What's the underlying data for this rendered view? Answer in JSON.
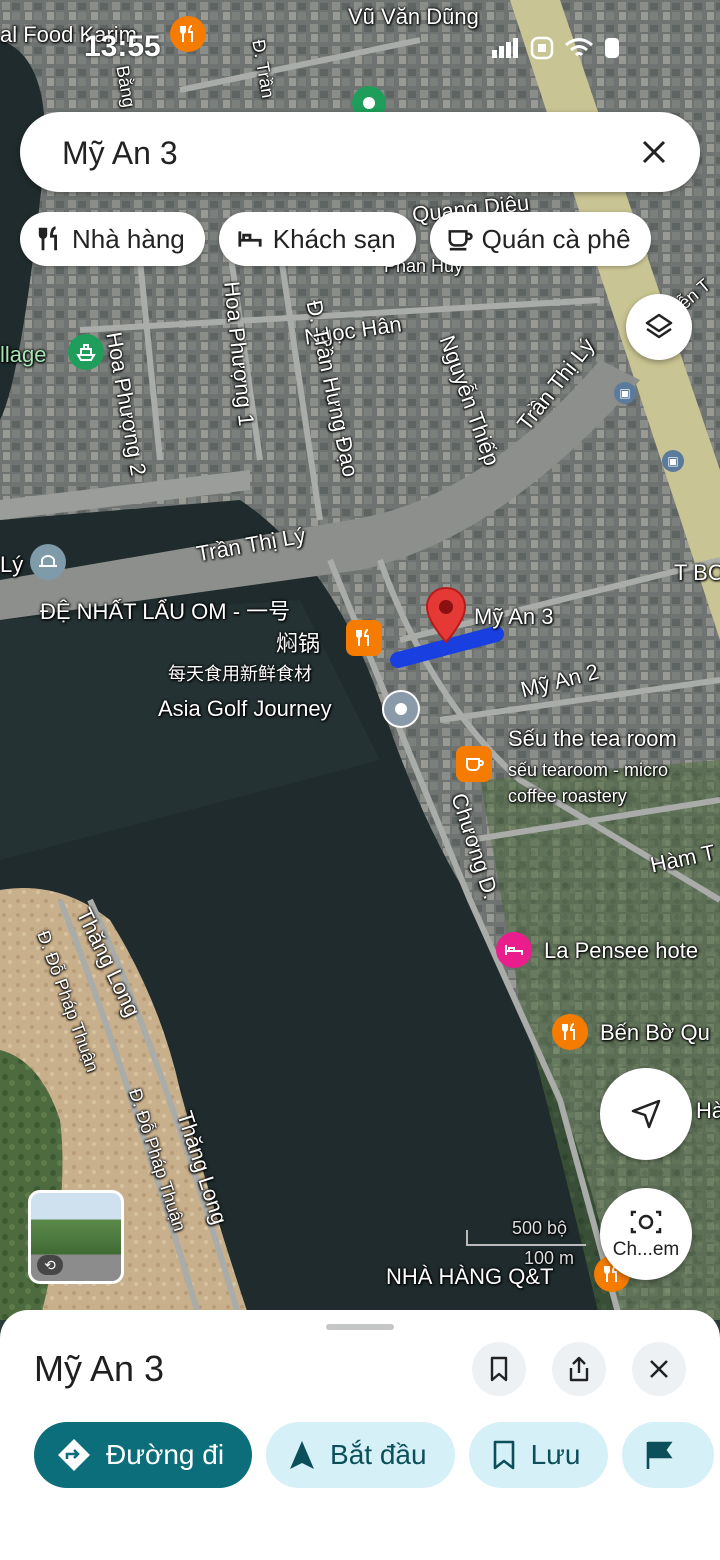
{
  "status": {
    "time": "13:55"
  },
  "search": {
    "value": "Mỹ An 3",
    "placeholder": ""
  },
  "chips": [
    {
      "label": "Nhà hàng",
      "icon": "fork-knife-icon"
    },
    {
      "label": "Khách sạn",
      "icon": "bed-icon"
    },
    {
      "label": "Quán cà phê",
      "icon": "coffee-cup-icon"
    }
  ],
  "map": {
    "labels": {
      "vu_van_dung": "Vũ Văn Dũng",
      "quang_dieu": "Quang Diệu",
      "phan_huy": "Phan Huy",
      "ngoc_han": "Ngọc Hân",
      "hoa_phuong_2": "Hoa Phượng 2",
      "hoa_phuong_1": "Hoa Phượng 1",
      "d_tran_hung_dao": "Đ. Trần Hưng Đạo",
      "nguyen_thiep": "Nguyễn Thiếp",
      "tran_thi_ly_1": "Trần Thị Lý",
      "tran_thi_ly_2": "Trần Thị Lý",
      "ly": "Lý",
      "t_bo": "T BO",
      "village": "llage",
      "food": "al Food Karim",
      "d_tran": "Đ. Trần",
      "bang": "Bằng",
      "nguyen": "uyễn T",
      "my_an_2": "Mỹ An 2",
      "chuong_d": "Chương D.",
      "ham_t": "Hàm T",
      "thang_long_1": "Thăng Long",
      "thang_long_2": "Thăng Long",
      "do_phap_thuan_1": "Đ. Đỗ Pháp Thuận",
      "do_phap_thuan_2": "Đ. Đỗ Pháp Thuận",
      "ha": "Hà",
      "d": "Đ"
    },
    "pois": {
      "lau_om_line1": "ĐỆ NHẤT LẨU OM - 一号",
      "lau_om_line2": "焖锅",
      "lau_om_line3": "每天食用新鲜食材",
      "asia_golf": "Asia Golf Journey",
      "seu_tea": "Sếu the tea room",
      "seu_sub1": "sếu tearoom - micro",
      "seu_sub2": "coffee roastery",
      "la_pensee": "La Pensee hote",
      "ben_bo": "Bến Bờ Qu",
      "nha_hang_qt": "NHÀ HÀNG Q&T"
    },
    "pin_label": "Mỹ An 3",
    "scale": {
      "top": "500 bộ",
      "bottom": "100 m"
    },
    "camera_label": "Ch...em"
  },
  "sheet": {
    "title": "Mỹ An 3",
    "actions": [
      {
        "label": "Đường đi",
        "icon": "directions-icon"
      },
      {
        "label": "Bắt đầu",
        "icon": "navigation-arrow-icon"
      },
      {
        "label": "Lưu",
        "icon": "bookmark-icon"
      }
    ]
  },
  "colors": {
    "accent": "#0b6e7a",
    "tonal": "#d6f0f7",
    "pin": "#e53935",
    "route": "#1a3fe0",
    "poi_food": "#f57c00",
    "poi_hotel": "#e91e8c"
  }
}
